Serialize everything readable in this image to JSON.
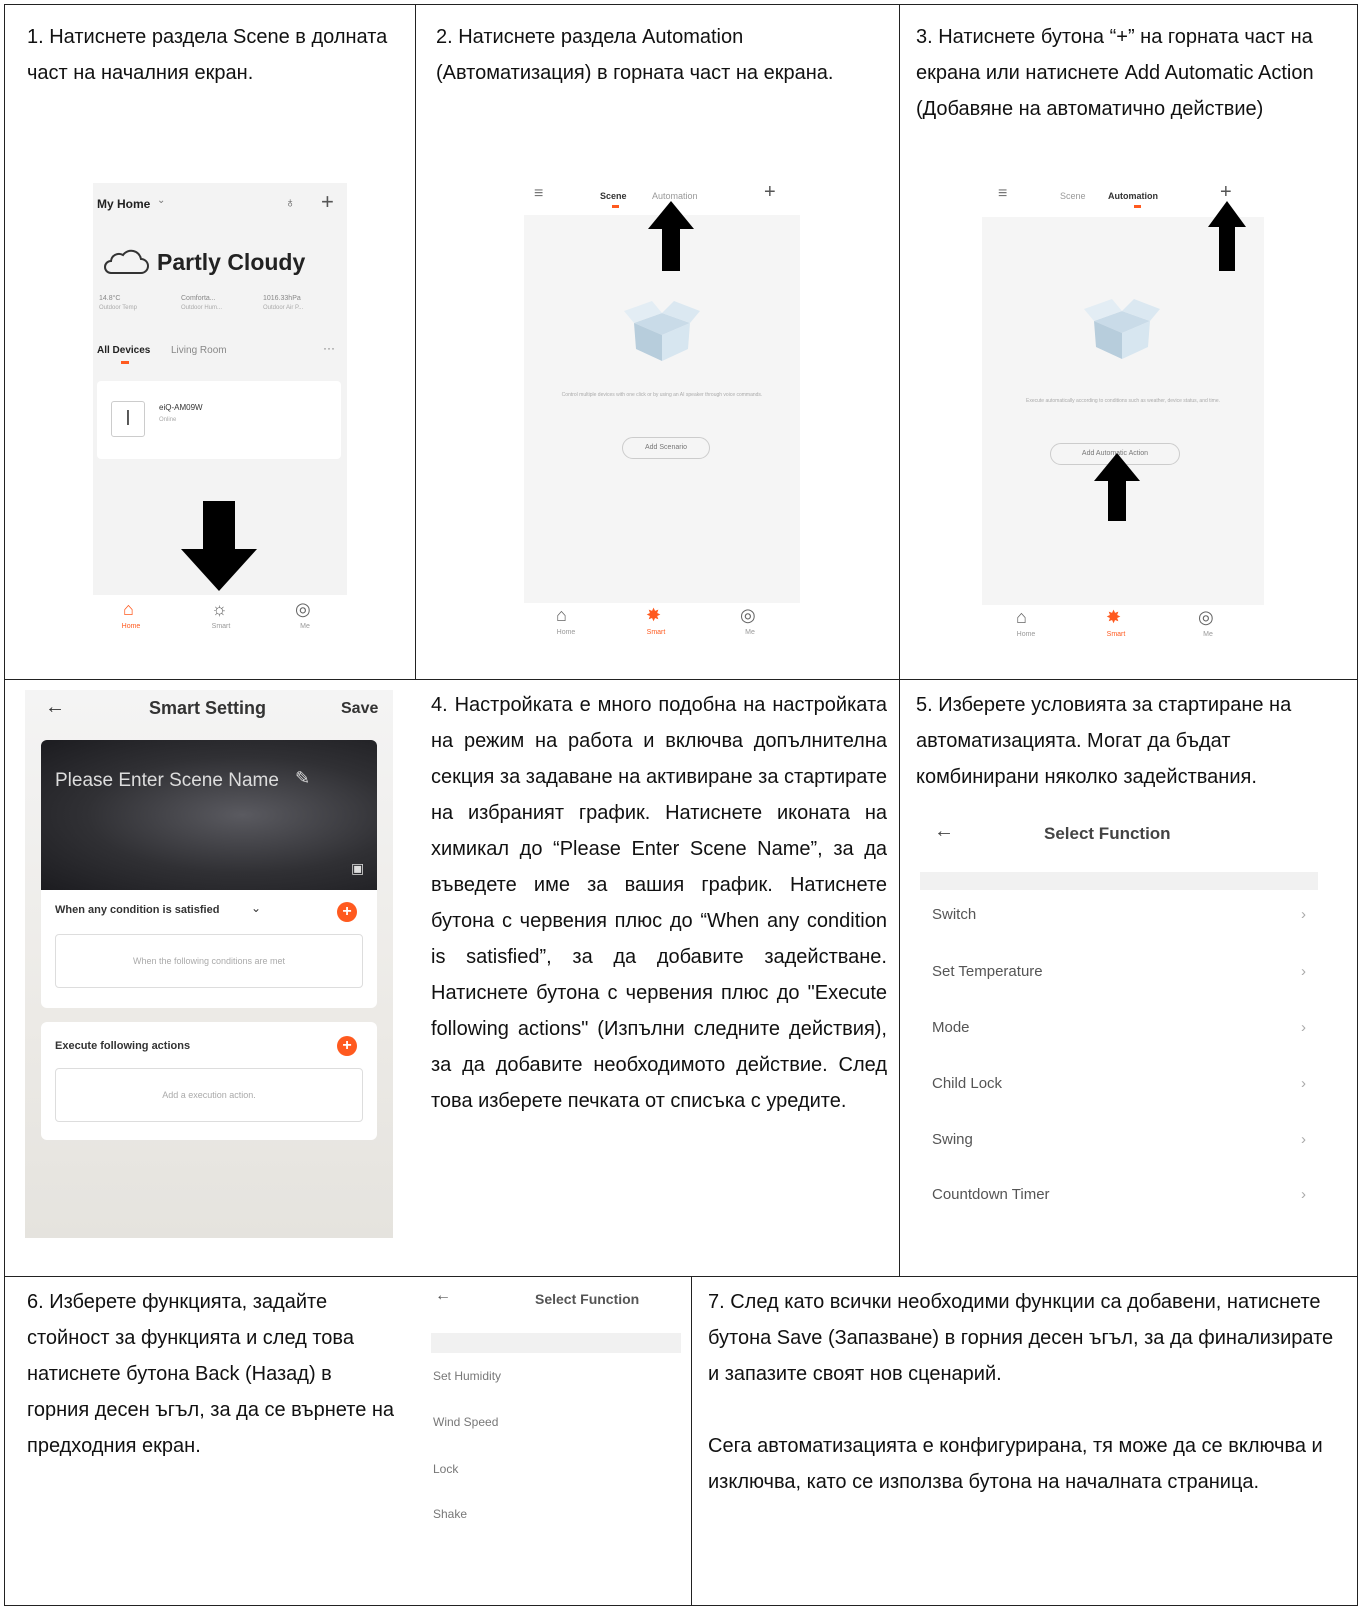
{
  "steps": {
    "s1": "1. Натиснете раздела Scene в долната част на началния екран.",
    "s2": "2. Натиснете раздела Automation (Автоматизация) в горната част на екрана.",
    "s3": "3. Натиснете бутона “+” на горната част на екрана или натиснете Add Automatic Action (Добавяне на автоматично действие)",
    "s4": "4. Настройката е много подобна на настройката на режим на работа и включва допълнителна секция за задаване на активиране за стартирате на избраният график. Натиснете иконата на химикал до “Please Enter Scene Name”, за да въведете име за вашия график. Натиснете бутона с червения плюс до “When any condition is satisfied”, за да добавите задействане. Натиснете бутона с червения плюс до \"Execute following actions\" (Изпълни следните действия), за да добавите необходимото действие. След това изберете печката от списъка с уредите.",
    "s5": "5. Изберете условията за стартиране на автоматизацията. Могат да бъдат комбинирани няколко задействания.",
    "s6": "6. Изберете функцията, задайте стойност за функцията и след това натиснете бутона Back (Назад) в горния десен ъгъл, за да се върнете на предходния екран.",
    "s7a": "7. След като всички необходими функции са добавени, натиснете бутона Save (Запазване) в горния десен ъгъл, за да финализирате и запазите своят нов сценарий.",
    "s7b": "Сега автоматизацията е конфигурирана, тя може да се включва и изключва, като се използва бутона на началната страница."
  },
  "home": {
    "title": "My Home",
    "weather": "Partly Cloudy",
    "temp": "14.8°C",
    "temp_l": "Outdoor Temp",
    "hum": "Comforta...",
    "hum_l": "Outdoor Hum...",
    "press": "1016.33hPa",
    "press_l": "Outdoor Air P...",
    "tab1": "All Devices",
    "tab2": "Living Room",
    "device": "eiQ-AM09W",
    "device_status": "Online",
    "nav_home": "Home",
    "nav_smart": "Smart",
    "nav_me": "Me"
  },
  "scene": {
    "tab_scene": "Scene",
    "tab_auto": "Automation",
    "empty_text": "Control multiple devices with one click or by using an AI speaker through voice commands.",
    "add_btn": "Add Scenario",
    "nav_home": "Home",
    "nav_smart": "Smart",
    "nav_me": "Me"
  },
  "auto": {
    "tab_scene": "Scene",
    "tab_auto": "Automation",
    "empty_text": "Execute automatically according to conditions such as weather, device status, and time.",
    "add_btn": "Add Automatic Action",
    "nav_home": "Home",
    "nav_smart": "Smart",
    "nav_me": "Me"
  },
  "smart": {
    "title": "Smart Setting",
    "save": "Save",
    "scene_name": "Please Enter Scene Name",
    "cond_title": "When any condition is satisfied",
    "cond_body": "When the following conditions are met",
    "exec_title": "Execute following actions",
    "exec_body": "Add a execution action."
  },
  "func1": {
    "title": "Select Function",
    "items": [
      "Switch",
      "Set Temperature",
      "Mode",
      "Child Lock",
      "Swing",
      "Countdown Timer"
    ]
  },
  "func2": {
    "title": "Select Function",
    "items": [
      "Set Humidity",
      "Wind Speed",
      "Lock",
      "Shake"
    ]
  },
  "colors": {
    "accent": "#ff5a1f",
    "border": "#222222"
  }
}
